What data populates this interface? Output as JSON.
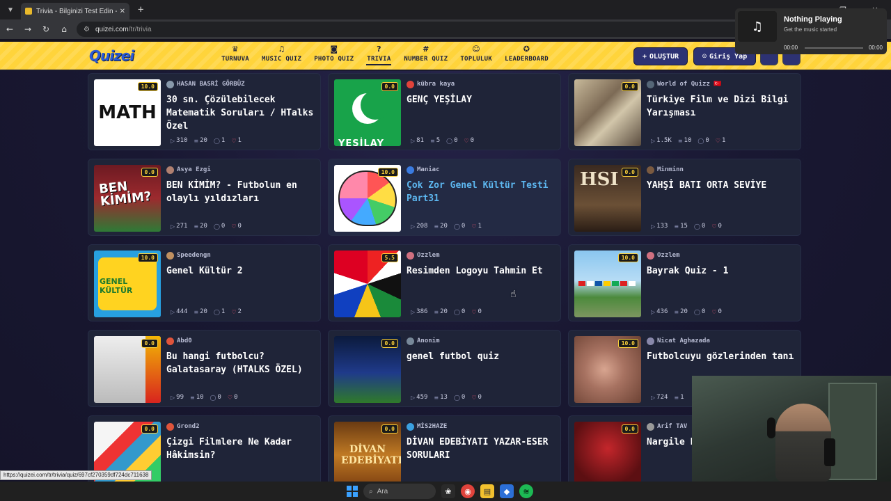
{
  "browser": {
    "tab_title": "Trivia - Bilginizi Test Edin - Quizei",
    "url_host": "quizei.com",
    "url_path": "/tr/trivia",
    "status_url": "https://quizei.com/tr/trivia/quiz/697cf270359df724dc711638"
  },
  "site": {
    "logo": "Quizei",
    "nav": [
      {
        "label": "TURNUVA",
        "icon": "trophy-icon",
        "glyph": "♛"
      },
      {
        "label": "MUSIC QUIZ",
        "icon": "music-icon",
        "glyph": "♫"
      },
      {
        "label": "PHOTO QUIZ",
        "icon": "camera-icon",
        "glyph": "◙"
      },
      {
        "label": "TRIVIA",
        "icon": "question-icon",
        "glyph": "?"
      },
      {
        "label": "NUMBER QUIZ",
        "icon": "hash-icon",
        "glyph": "#"
      },
      {
        "label": "TOPLULUK",
        "icon": "users-icon",
        "glyph": "☺"
      },
      {
        "label": "LEADERBOARD",
        "icon": "medal-icon",
        "glyph": "✪"
      }
    ],
    "active_nav": "TRIVIA",
    "create_label": "OLUŞTUR",
    "login_label": "Giriş Yap"
  },
  "quizzes": [
    {
      "rating": "10.0",
      "author": "HASAN BASRİ GÖRBÜZ",
      "title": "30 sn. Çözülebilecek Matematik Soruları / HTalks Özel",
      "plays": "310",
      "questions": "20",
      "comments": "1",
      "likes": "1",
      "thumb": "math",
      "avatar_color": "#8899aa"
    },
    {
      "rating": "0.0",
      "author": "kübra kaya",
      "title": "GENÇ YEŞİLAY",
      "plays": "81",
      "questions": "5",
      "comments": "0",
      "likes": "0",
      "thumb": "yesilay",
      "avatar_color": "#e0433b"
    },
    {
      "rating": "0.0",
      "author": "World of Quizz 🇹🇷",
      "title": "Türkiye Film ve Dizi Bilgi Yarışması",
      "plays": "1.5K",
      "questions": "10",
      "comments": "0",
      "likes": "1",
      "thumb": "posters",
      "avatar_color": "#556677"
    },
    {
      "rating": "0.0",
      "author": "Asya Ezgi",
      "title": "BEN KİMİM? - Futbolun en olaylı yıldızları",
      "plays": "271",
      "questions": "20",
      "comments": "0",
      "likes": "0",
      "thumb": "ben",
      "avatar_color": "#b08070"
    },
    {
      "rating": "10.0",
      "author": "Maniac",
      "title": "Çok Zor Genel Kültür Testi Part31",
      "plays": "208",
      "questions": "20",
      "comments": "0",
      "likes": "1",
      "thumb": "brain",
      "avatar_color": "#3a7be0"
    },
    {
      "rating": "0.0",
      "author": "Minminn",
      "title": "YAHŞİ BATI ORTA SEVİYE",
      "plays": "133",
      "questions": "15",
      "comments": "0",
      "likes": "0",
      "thumb": "western",
      "avatar_color": "#7a5a40"
    },
    {
      "rating": "10.0",
      "author": "Speedengn",
      "title": "Genel Kültür 2",
      "plays": "444",
      "questions": "20",
      "comments": "1",
      "likes": "2",
      "thumb": "genel",
      "avatar_color": "#c09060"
    },
    {
      "rating": "5.5",
      "author": "Ozzlem",
      "title": "Resimden Logoyu Tahmin Et",
      "plays": "386",
      "questions": "20",
      "comments": "0",
      "likes": "0",
      "thumb": "logos",
      "avatar_color": "#d07080"
    },
    {
      "rating": "10.0",
      "author": "Ozzlem",
      "title": "Bayrak Quiz - 1",
      "plays": "436",
      "questions": "20",
      "comments": "0",
      "likes": "0",
      "thumb": "flags",
      "avatar_color": "#d07080"
    },
    {
      "rating": "0.0",
      "author": "Abd0",
      "title": "Bu hangi futbolcu? Galatasaray (HTALKS ÖZEL)",
      "plays": "99",
      "questions": "10",
      "comments": "0",
      "likes": "0",
      "thumb": "bw",
      "avatar_color": "#e0543b"
    },
    {
      "rating": "0.0",
      "author": "Anonim",
      "title": "genel futbol quiz",
      "plays": "459",
      "questions": "13",
      "comments": "0",
      "likes": "0",
      "thumb": "football",
      "avatar_color": "#778899"
    },
    {
      "rating": "10.0",
      "author": "Nicat Aghazada",
      "title": "Futbolcuyu gözlerinden tanı",
      "plays": "724",
      "questions": "1",
      "comments": "",
      "likes": "",
      "thumb": "eye",
      "avatar_color": "#8888aa"
    },
    {
      "rating": "0.0",
      "author": "Grond2",
      "title": "Çizgi Filmlere Ne Kadar Hâkimsin?",
      "plays": "",
      "questions": "",
      "comments": "",
      "likes": "",
      "thumb": "cartoon",
      "avatar_color": "#e0543b"
    },
    {
      "rating": "0.0",
      "author": "MİS2HAZE",
      "title": "DİVAN EDEBİYATI YAZAR-ESER SORULARI",
      "plays": "",
      "questions": "",
      "comments": "",
      "likes": "",
      "thumb": "divan",
      "avatar_color": "#3aa0e0"
    },
    {
      "rating": "0.0",
      "author": "Arif TAV",
      "title": "Nargile PLACE)",
      "plays": "",
      "questions": "",
      "comments": "",
      "likes": "",
      "thumb": "nargile",
      "avatar_color": "#999999"
    }
  ],
  "thumb_text": {
    "math": "MATH",
    "yesilay": "YEŞİLAY",
    "ben": "BEN KİMİM?",
    "western": "HSI",
    "genel": "GENEL KÜLTÜR",
    "divan": "DİVAN EDEBİYATI"
  },
  "media": {
    "title": "Nothing Playing",
    "subtitle": "Get the music started",
    "time_left": "00:00",
    "time_right": "00:00"
  },
  "taskbar": {
    "search_placeholder": "Ara"
  }
}
